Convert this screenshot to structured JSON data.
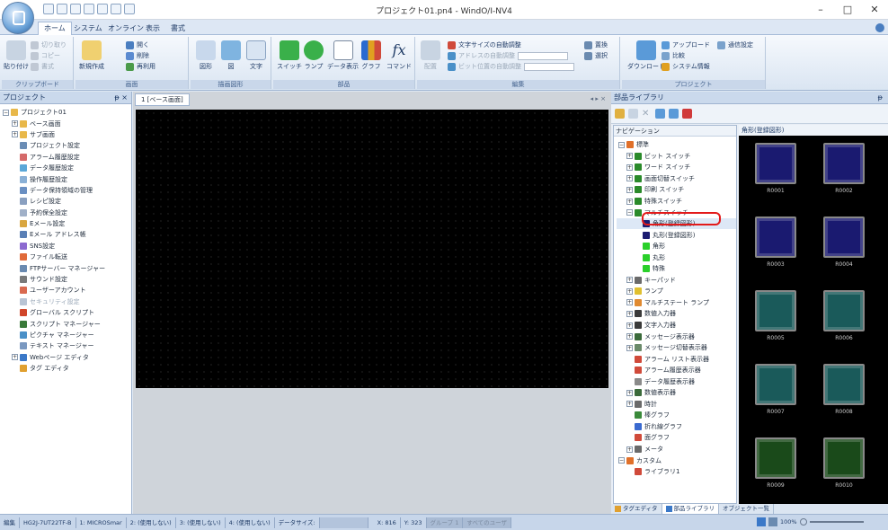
{
  "window": {
    "title": "プロジェクト01.pn4 - WindO/I-NV4",
    "minimize": "–",
    "maximize": "□",
    "close": "✕"
  },
  "ribbon_tabs": [
    "ホーム",
    "システム",
    "オンライン",
    "表示",
    "書式"
  ],
  "ribbon": {
    "clipboard": {
      "label": "クリップボード",
      "paste": "貼り付け",
      "cut": "切り取り",
      "copy": "コピー",
      "format": "書式"
    },
    "screen": {
      "label": "画面",
      "new": "新規作成",
      "open": "開く",
      "delete": "削除",
      "reopen": "再利用"
    },
    "drawing": {
      "label": "描画図形",
      "shape": "図形",
      "chart": "図",
      "text": "文字"
    },
    "parts": {
      "label": "部品",
      "switch": "スイッチ",
      "lamp": "ランプ",
      "data_display": "データ表示",
      "graph": "グラフ",
      "command": "コマンド"
    },
    "edit": {
      "label": "編集",
      "arrange": "配置",
      "auto_text_size": "文字サイズの自動調整",
      "auto_address": "アドレスの自動調整",
      "auto_bit": "ビット位置の自動調整",
      "replace": "置換",
      "select": "選択"
    },
    "project": {
      "label": "プロジェクト",
      "download": "ダウンロード",
      "upload": "アップロード",
      "compare": "比較",
      "sysinfo": "システム情報",
      "comm": "通信設定"
    }
  },
  "left_pane": {
    "title": "プロジェクト",
    "pin": "ᵽ ×",
    "tree": [
      {
        "label": "プロジェクト01",
        "level": 0,
        "icon": "folder-icon",
        "color": "#e8b84a",
        "exp": "−"
      },
      {
        "label": "ベース画面",
        "level": 1,
        "icon": "folder-icon",
        "color": "#e8b84a",
        "exp": "+"
      },
      {
        "label": "サブ画面",
        "level": 1,
        "icon": "folder-icon",
        "color": "#e8b84a",
        "exp": "+"
      },
      {
        "label": "プロジェクト設定",
        "level": 1,
        "icon": "settings-icon",
        "color": "#6b8db5",
        "exp": ""
      },
      {
        "label": "アラーム履歴設定",
        "level": 1,
        "icon": "alarm-icon",
        "color": "#d56a6a",
        "exp": ""
      },
      {
        "label": "データ履歴設定",
        "level": 1,
        "icon": "data-icon",
        "color": "#5aa7d8",
        "exp": ""
      },
      {
        "label": "操作履歴設定",
        "level": 1,
        "icon": "log-icon",
        "color": "#8ab0d6",
        "exp": ""
      },
      {
        "label": "データ保持領域の管理",
        "level": 1,
        "icon": "storage-icon",
        "color": "#6a8fc2",
        "exp": ""
      },
      {
        "label": "レシピ設定",
        "level": 1,
        "icon": "recipe-icon",
        "color": "#8aa0c0",
        "exp": ""
      },
      {
        "label": "予約保全設定",
        "level": 1,
        "icon": "maintenance-icon",
        "color": "#a0b0c8",
        "exp": ""
      },
      {
        "label": "Eメール設定",
        "level": 1,
        "icon": "mail-icon",
        "color": "#d9a640",
        "exp": ""
      },
      {
        "label": "Eメール アドレス帳",
        "level": 1,
        "icon": "addressbook-icon",
        "color": "#5a7fb5",
        "exp": ""
      },
      {
        "label": "SNS設定",
        "level": 1,
        "icon": "sns-icon",
        "color": "#8c6ad0",
        "exp": ""
      },
      {
        "label": "ファイル転送",
        "level": 1,
        "icon": "file-transfer-icon",
        "color": "#e06a3a",
        "exp": ""
      },
      {
        "label": "FTPサーバー マネージャー",
        "level": 1,
        "icon": "ftp-icon",
        "color": "#6a8ab0",
        "exp": ""
      },
      {
        "label": "サウンド設定",
        "level": 1,
        "icon": "sound-icon",
        "color": "#7a7a7a",
        "exp": ""
      },
      {
        "label": "ユーザーアカウント",
        "level": 1,
        "icon": "user-icon",
        "color": "#d96a50",
        "exp": ""
      },
      {
        "label": "セキュリティ設定",
        "level": 1,
        "icon": "security-icon",
        "color": "#b8c4d4",
        "exp": "",
        "dim": true
      },
      {
        "label": "グローバル スクリプト",
        "level": 1,
        "icon": "script-icon",
        "color": "#d0452a",
        "exp": ""
      },
      {
        "label": "スクリプト マネージャー",
        "level": 1,
        "icon": "script-manager-icon",
        "color": "#3a7a3a",
        "exp": ""
      },
      {
        "label": "ピクチャ マネージャー",
        "level": 1,
        "icon": "picture-icon",
        "color": "#4a90c8",
        "exp": ""
      },
      {
        "label": "テキスト マネージャー",
        "level": 1,
        "icon": "text-icon",
        "color": "#7a98c0",
        "exp": ""
      },
      {
        "label": "Webページ エディタ",
        "level": 1,
        "icon": "web-icon",
        "color": "#3a78c8",
        "exp": "+"
      },
      {
        "label": "タグ エディタ",
        "level": 1,
        "icon": "tag-icon",
        "color": "#e0a030",
        "exp": ""
      }
    ]
  },
  "center": {
    "tab": "1 [ベース画面]",
    "arrows": "◂ ▸ ×"
  },
  "right_pane": {
    "title": "部品ライブラリ",
    "pin": "ᵽ",
    "nav_title": "ナビゲーション",
    "parts_title": "角形(登録図形)",
    "nav": [
      {
        "label": "標準",
        "level": 0,
        "exp": "−",
        "color": "#e0702a"
      },
      {
        "label": "ビット スイッチ",
        "level": 1,
        "exp": "+",
        "color": "#2a8a2a"
      },
      {
        "label": "ワード スイッチ",
        "level": 1,
        "exp": "+",
        "color": "#2a8a2a"
      },
      {
        "label": "画面切替スイッチ",
        "level": 1,
        "exp": "+",
        "color": "#2a8a2a"
      },
      {
        "label": "印刷 スイッチ",
        "level": 1,
        "exp": "+",
        "color": "#2a8a2a"
      },
      {
        "label": "特殊スイッチ",
        "level": 1,
        "exp": "+",
        "color": "#2a8a2a"
      },
      {
        "label": "マルチスイッチ",
        "level": 1,
        "exp": "−",
        "color": "#2a8a2a"
      },
      {
        "label": "角形(登録図形)",
        "level": 2,
        "exp": "",
        "color": "#1c1c70",
        "selected": true
      },
      {
        "label": "丸形(登録図形)",
        "level": 2,
        "exp": "",
        "color": "#1c1c70"
      },
      {
        "label": "角形",
        "level": 2,
        "exp": "",
        "color": "#2ad02a"
      },
      {
        "label": "丸形",
        "level": 2,
        "exp": "",
        "color": "#2ad02a"
      },
      {
        "label": "特殊",
        "level": 2,
        "exp": "",
        "color": "#2ad02a"
      },
      {
        "label": "キーパッド",
        "level": 1,
        "exp": "+",
        "color": "#6a6a6a"
      },
      {
        "label": "ランプ",
        "level": 1,
        "exp": "+",
        "color": "#e0c030"
      },
      {
        "label": "マルチステート ランプ",
        "level": 1,
        "exp": "+",
        "color": "#e08a30"
      },
      {
        "label": "数値入力器",
        "level": 1,
        "exp": "+",
        "color": "#3a3a3a"
      },
      {
        "label": "文字入力器",
        "level": 1,
        "exp": "+",
        "color": "#3a3a3a"
      },
      {
        "label": "メッセージ表示器",
        "level": 1,
        "exp": "+",
        "color": "#3a6a3a"
      },
      {
        "label": "メッセージ切替表示器",
        "level": 1,
        "exp": "+",
        "color": "#6a8a6a"
      },
      {
        "label": "アラーム リスト表示器",
        "level": 1,
        "exp": "",
        "color": "#d04a3a"
      },
      {
        "label": "アラーム履歴表示器",
        "level": 1,
        "exp": "",
        "color": "#d04a3a"
      },
      {
        "label": "データ履歴表示器",
        "level": 1,
        "exp": "",
        "color": "#8a8a8a"
      },
      {
        "label": "数値表示器",
        "level": 1,
        "exp": "+",
        "color": "#3a6a3a"
      },
      {
        "label": "時計",
        "level": 1,
        "exp": "+",
        "color": "#6a6a6a"
      },
      {
        "label": "棒グラフ",
        "level": 1,
        "exp": "",
        "color": "#3a8a3a"
      },
      {
        "label": "折れ線グラフ",
        "level": 1,
        "exp": "",
        "color": "#3a6ad0"
      },
      {
        "label": "面グラフ",
        "level": 1,
        "exp": "",
        "color": "#d04a3a"
      },
      {
        "label": "メータ",
        "level": 1,
        "exp": "+",
        "color": "#6a6a6a"
      },
      {
        "label": "カスタム",
        "level": 0,
        "exp": "−",
        "color": "#e0702a"
      },
      {
        "label": "ライブラリ1",
        "level": 1,
        "exp": "",
        "color": "#d04a3a"
      }
    ],
    "parts": [
      {
        "label": "R0001",
        "color": "#1a1a70"
      },
      {
        "label": "R0002",
        "color": "#1a1a70"
      },
      {
        "label": "R0003",
        "color": "#1a1a70"
      },
      {
        "label": "R0004",
        "color": "#1a1a70"
      },
      {
        "label": "R0005",
        "color": "#1a5a5a"
      },
      {
        "label": "R0006",
        "color": "#1a5a5a"
      },
      {
        "label": "R0007",
        "color": "#1a5a5a"
      },
      {
        "label": "R0008",
        "color": "#1a5a5a"
      },
      {
        "label": "R0009",
        "color": "#1a4a1a"
      },
      {
        "label": "R0010",
        "color": "#1a4a1a"
      }
    ],
    "bottom_tabs": [
      "タグエディタ",
      "部品ライブラリ",
      "オブジェクト一覧"
    ]
  },
  "status": {
    "items": [
      "編集",
      "HG2J-7UT22TF-B",
      "1: MICROSmar",
      "2: (使用しない)",
      "3: (使用しない)",
      "4: (使用しない)",
      "データサイズ:"
    ],
    "x": "X: 816",
    "y": "Y: 323",
    "group": "グループ 1",
    "users": "すべてのユーザ",
    "zoom": "100%"
  }
}
